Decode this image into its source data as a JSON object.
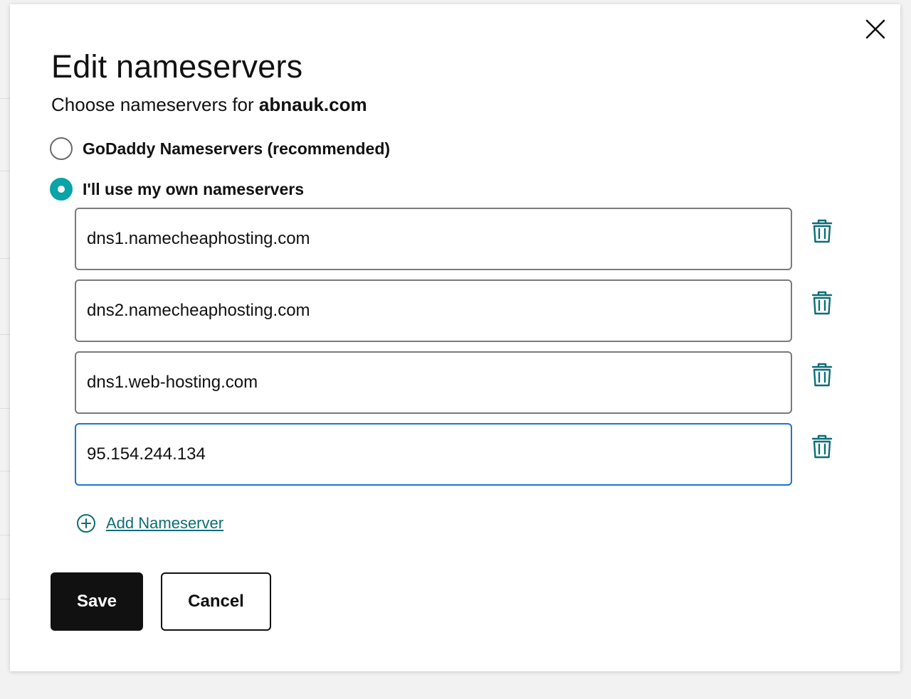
{
  "dialog": {
    "title": "Edit nameservers",
    "subtitle_prefix": "Choose nameservers for ",
    "domain": "abnauk.com"
  },
  "options": [
    {
      "label": "GoDaddy Nameservers (recommended)",
      "selected": false
    },
    {
      "label": "I'll use my own nameservers",
      "selected": true
    }
  ],
  "nameservers": [
    {
      "value": "dns1.namecheaphosting.com"
    },
    {
      "value": "dns2.namecheaphosting.com"
    },
    {
      "value": "dns1.web-hosting.com"
    },
    {
      "value": "95.154.244.134"
    }
  ],
  "add_nameserver_label": "Add Nameserver",
  "buttons": {
    "save": "Save",
    "cancel": "Cancel"
  },
  "colors": {
    "accent": "#09a3a8",
    "link": "#0b6e75",
    "focus": "#1976d2",
    "primary_button": "#111111"
  },
  "icons": {
    "close": "close-icon",
    "delete": "trash-icon",
    "add": "plus-circle-icon"
  }
}
